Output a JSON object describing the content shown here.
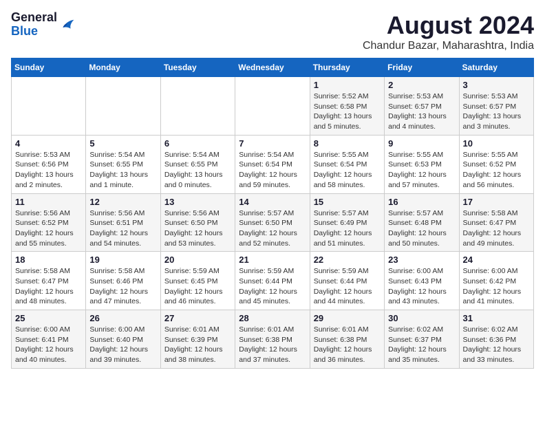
{
  "header": {
    "logo_general": "General",
    "logo_blue": "Blue",
    "main_title": "August 2024",
    "subtitle": "Chandur Bazar, Maharashtra, India"
  },
  "weekdays": [
    "Sunday",
    "Monday",
    "Tuesday",
    "Wednesday",
    "Thursday",
    "Friday",
    "Saturday"
  ],
  "weeks": [
    [
      {
        "day": "",
        "info": ""
      },
      {
        "day": "",
        "info": ""
      },
      {
        "day": "",
        "info": ""
      },
      {
        "day": "",
        "info": ""
      },
      {
        "day": "1",
        "info": "Sunrise: 5:52 AM\nSunset: 6:58 PM\nDaylight: 13 hours\nand 5 minutes."
      },
      {
        "day": "2",
        "info": "Sunrise: 5:53 AM\nSunset: 6:57 PM\nDaylight: 13 hours\nand 4 minutes."
      },
      {
        "day": "3",
        "info": "Sunrise: 5:53 AM\nSunset: 6:57 PM\nDaylight: 13 hours\nand 3 minutes."
      }
    ],
    [
      {
        "day": "4",
        "info": "Sunrise: 5:53 AM\nSunset: 6:56 PM\nDaylight: 13 hours\nand 2 minutes."
      },
      {
        "day": "5",
        "info": "Sunrise: 5:54 AM\nSunset: 6:55 PM\nDaylight: 13 hours\nand 1 minute."
      },
      {
        "day": "6",
        "info": "Sunrise: 5:54 AM\nSunset: 6:55 PM\nDaylight: 13 hours\nand 0 minutes."
      },
      {
        "day": "7",
        "info": "Sunrise: 5:54 AM\nSunset: 6:54 PM\nDaylight: 12 hours\nand 59 minutes."
      },
      {
        "day": "8",
        "info": "Sunrise: 5:55 AM\nSunset: 6:54 PM\nDaylight: 12 hours\nand 58 minutes."
      },
      {
        "day": "9",
        "info": "Sunrise: 5:55 AM\nSunset: 6:53 PM\nDaylight: 12 hours\nand 57 minutes."
      },
      {
        "day": "10",
        "info": "Sunrise: 5:55 AM\nSunset: 6:52 PM\nDaylight: 12 hours\nand 56 minutes."
      }
    ],
    [
      {
        "day": "11",
        "info": "Sunrise: 5:56 AM\nSunset: 6:52 PM\nDaylight: 12 hours\nand 55 minutes."
      },
      {
        "day": "12",
        "info": "Sunrise: 5:56 AM\nSunset: 6:51 PM\nDaylight: 12 hours\nand 54 minutes."
      },
      {
        "day": "13",
        "info": "Sunrise: 5:56 AM\nSunset: 6:50 PM\nDaylight: 12 hours\nand 53 minutes."
      },
      {
        "day": "14",
        "info": "Sunrise: 5:57 AM\nSunset: 6:50 PM\nDaylight: 12 hours\nand 52 minutes."
      },
      {
        "day": "15",
        "info": "Sunrise: 5:57 AM\nSunset: 6:49 PM\nDaylight: 12 hours\nand 51 minutes."
      },
      {
        "day": "16",
        "info": "Sunrise: 5:57 AM\nSunset: 6:48 PM\nDaylight: 12 hours\nand 50 minutes."
      },
      {
        "day": "17",
        "info": "Sunrise: 5:58 AM\nSunset: 6:47 PM\nDaylight: 12 hours\nand 49 minutes."
      }
    ],
    [
      {
        "day": "18",
        "info": "Sunrise: 5:58 AM\nSunset: 6:47 PM\nDaylight: 12 hours\nand 48 minutes."
      },
      {
        "day": "19",
        "info": "Sunrise: 5:58 AM\nSunset: 6:46 PM\nDaylight: 12 hours\nand 47 minutes."
      },
      {
        "day": "20",
        "info": "Sunrise: 5:59 AM\nSunset: 6:45 PM\nDaylight: 12 hours\nand 46 minutes."
      },
      {
        "day": "21",
        "info": "Sunrise: 5:59 AM\nSunset: 6:44 PM\nDaylight: 12 hours\nand 45 minutes."
      },
      {
        "day": "22",
        "info": "Sunrise: 5:59 AM\nSunset: 6:44 PM\nDaylight: 12 hours\nand 44 minutes."
      },
      {
        "day": "23",
        "info": "Sunrise: 6:00 AM\nSunset: 6:43 PM\nDaylight: 12 hours\nand 43 minutes."
      },
      {
        "day": "24",
        "info": "Sunrise: 6:00 AM\nSunset: 6:42 PM\nDaylight: 12 hours\nand 41 minutes."
      }
    ],
    [
      {
        "day": "25",
        "info": "Sunrise: 6:00 AM\nSunset: 6:41 PM\nDaylight: 12 hours\nand 40 minutes."
      },
      {
        "day": "26",
        "info": "Sunrise: 6:00 AM\nSunset: 6:40 PM\nDaylight: 12 hours\nand 39 minutes."
      },
      {
        "day": "27",
        "info": "Sunrise: 6:01 AM\nSunset: 6:39 PM\nDaylight: 12 hours\nand 38 minutes."
      },
      {
        "day": "28",
        "info": "Sunrise: 6:01 AM\nSunset: 6:38 PM\nDaylight: 12 hours\nand 37 minutes."
      },
      {
        "day": "29",
        "info": "Sunrise: 6:01 AM\nSunset: 6:38 PM\nDaylight: 12 hours\nand 36 minutes."
      },
      {
        "day": "30",
        "info": "Sunrise: 6:02 AM\nSunset: 6:37 PM\nDaylight: 12 hours\nand 35 minutes."
      },
      {
        "day": "31",
        "info": "Sunrise: 6:02 AM\nSunset: 6:36 PM\nDaylight: 12 hours\nand 33 minutes."
      }
    ]
  ]
}
